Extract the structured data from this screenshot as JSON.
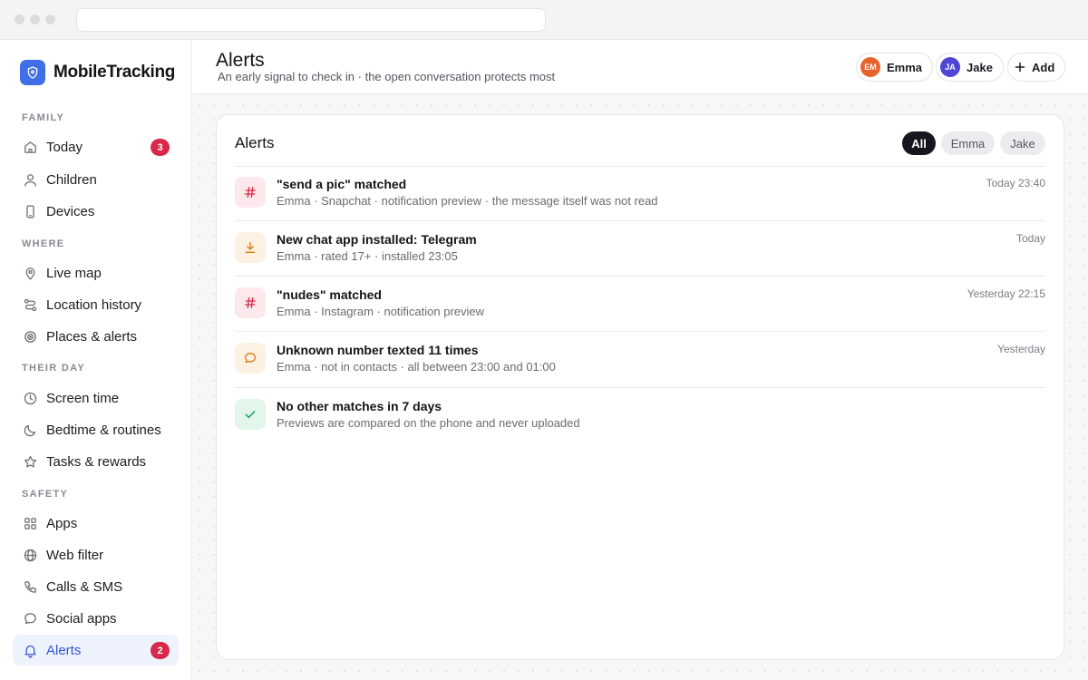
{
  "browser": {
    "url": ""
  },
  "brand": {
    "name": "MobileTracking"
  },
  "sidebar": {
    "sections": [
      {
        "label": "FAMILY",
        "items": [
          {
            "label": "Today",
            "icon": "home-icon",
            "badge": "3"
          },
          {
            "label": "Children",
            "icon": "person-icon"
          },
          {
            "label": "Devices",
            "icon": "phone-icon"
          }
        ]
      },
      {
        "label": "WHERE",
        "items": [
          {
            "label": "Live map",
            "icon": "map-pin-icon"
          },
          {
            "label": "Location history",
            "icon": "route-icon"
          },
          {
            "label": "Places & alerts",
            "icon": "target-icon"
          }
        ]
      },
      {
        "label": "THEIR DAY",
        "items": [
          {
            "label": "Screen time",
            "icon": "clock-icon"
          },
          {
            "label": "Bedtime & routines",
            "icon": "moon-icon"
          },
          {
            "label": "Tasks & rewards",
            "icon": "star-icon"
          }
        ]
      },
      {
        "label": "SAFETY",
        "items": [
          {
            "label": "Apps",
            "icon": "grid-icon"
          },
          {
            "label": "Web filter",
            "icon": "globe-icon"
          },
          {
            "label": "Calls & SMS",
            "icon": "phone-call-icon"
          },
          {
            "label": "Social apps",
            "icon": "chat-bubble-icon"
          },
          {
            "label": "Alerts",
            "icon": "bell-icon",
            "badge": "2",
            "active": true
          }
        ]
      }
    ]
  },
  "header": {
    "title": "Alerts",
    "subtitle": "An early signal to check in · the open conversation protects most",
    "children": [
      {
        "initials": "EM",
        "name": "Emma",
        "color": "#e8632c"
      },
      {
        "initials": "JA",
        "name": "Jake",
        "color": "#4f46d8"
      }
    ],
    "add_label": "Add"
  },
  "alerts_card": {
    "title": "Alerts",
    "filters": [
      {
        "label": "All",
        "active": true
      },
      {
        "label": "Emma"
      },
      {
        "label": "Jake"
      }
    ],
    "items": [
      {
        "title": "\"send a pic\" matched",
        "meta": "Emma · Snapchat · notification preview · the message itself was not read",
        "time": "Today 23:40",
        "icon": "hashtag-icon",
        "tone": "red"
      },
      {
        "title": "New chat app installed: Telegram",
        "meta": "Emma · rated 17+ · installed 23:05",
        "time": "Today",
        "icon": "download-icon",
        "tone": "amber"
      },
      {
        "title": "\"nudes\" matched",
        "meta": "Emma · Instagram · notification preview",
        "time": "Yesterday 22:15",
        "icon": "hashtag-icon",
        "tone": "red"
      },
      {
        "title": "Unknown number texted 11 times",
        "meta": "Emma · not in contacts · all between 23:00 and 01:00",
        "time": "Yesterday",
        "icon": "chat-bubble-icon",
        "tone": "amber"
      },
      {
        "title": "No other matches in 7 days",
        "meta": "Previews are compared on the phone and never uploaded",
        "time": "",
        "icon": "check-icon",
        "tone": "green"
      }
    ]
  },
  "colors": {
    "accent": "#3f6ee6",
    "badge": "#d9284a",
    "red_tone_bg": "#fde8ec",
    "red_tone_fg": "#d9284a",
    "amber_tone_bg": "#fdf1e3",
    "amber_tone_fg": "#d97a16",
    "green_tone_bg": "#e3f6ec",
    "green_tone_fg": "#1f9a5a"
  }
}
